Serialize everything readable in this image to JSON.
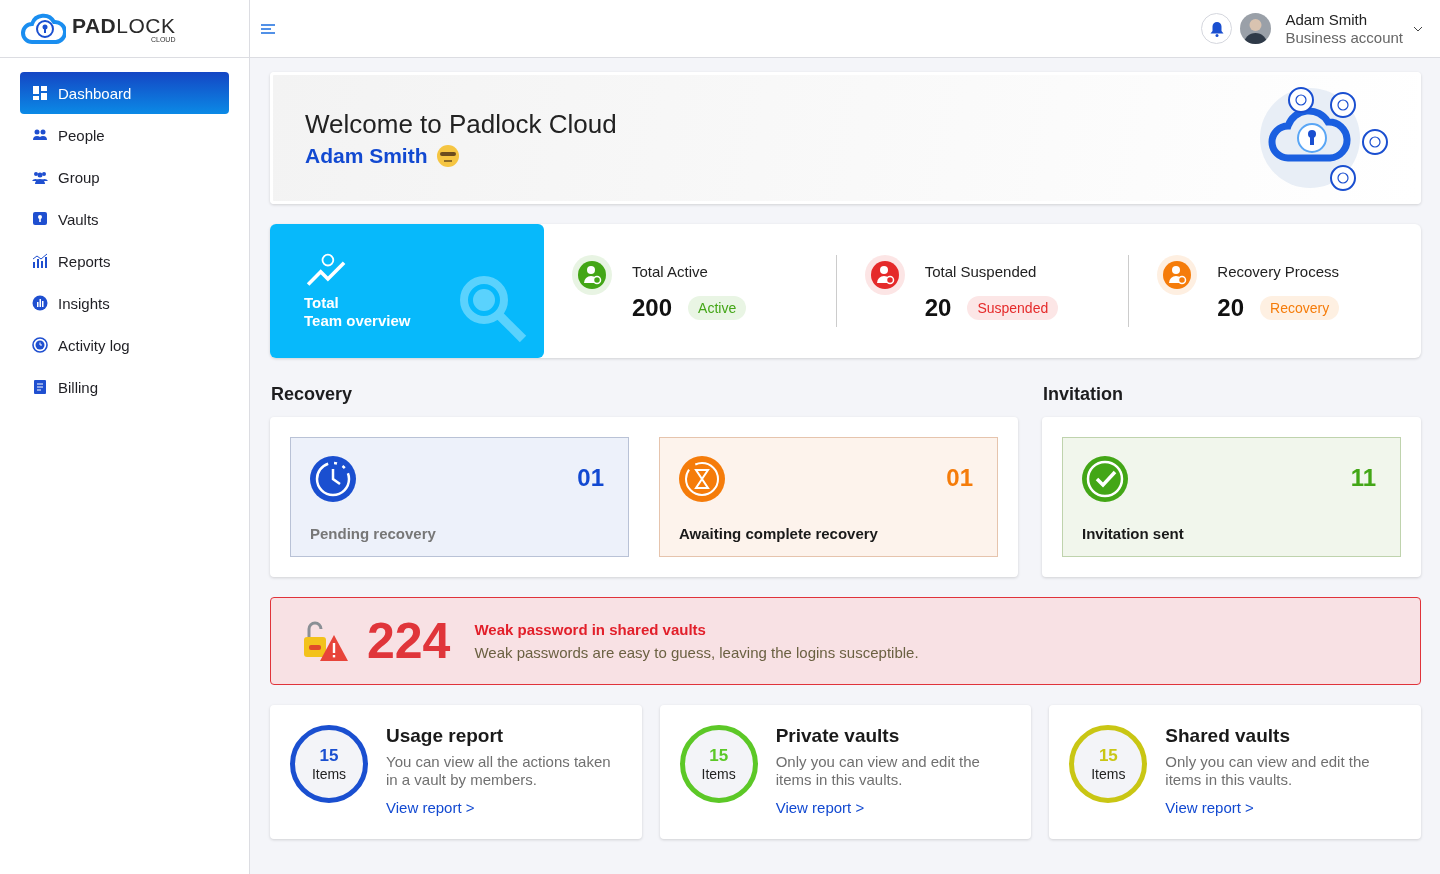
{
  "logo": {
    "name": "**PAD**LOCK",
    "sub": "CLOUD"
  },
  "sidebar": {
    "items": [
      {
        "label": "Dashboard",
        "kind": "grid",
        "selected": true
      },
      {
        "label": "People",
        "kind": "people",
        "selected": false
      },
      {
        "label": "Group",
        "kind": "group",
        "selected": false
      },
      {
        "label": "Vaults",
        "kind": "vault",
        "selected": false
      },
      {
        "label": "Reports",
        "kind": "chart",
        "selected": false
      },
      {
        "label": "Insights",
        "kind": "insight",
        "selected": false
      },
      {
        "label": "Activity log",
        "kind": "clock",
        "selected": false
      },
      {
        "label": "Billing",
        "kind": "bill",
        "selected": false
      }
    ]
  },
  "header": {
    "user_name": "Adam Smith",
    "account": "Business account"
  },
  "welcome": {
    "title": "Welcome to Padlock Cloud",
    "name": "Adam Smith"
  },
  "overview": {
    "line_1": "Total",
    "line_2": "Team overview"
  },
  "stats": [
    {
      "label": "Total Active",
      "value": "200",
      "badge": "Active",
      "color": "#43a616"
    },
    {
      "label": "Total Suspended",
      "value": "20",
      "badge": "Suspended",
      "color": "#e52a2a"
    },
    {
      "label": "Recovery Process",
      "value": "20",
      "badge": "Recovery",
      "color": "#f57c0a"
    }
  ],
  "recovery": {
    "title": "Recovery",
    "cards": [
      {
        "kind": "pending",
        "count": "01",
        "label": "Pending recovery"
      },
      {
        "kind": "awaiting",
        "count": "01",
        "label": "Awaiting complete recovery"
      }
    ]
  },
  "invitation": {
    "title": "Invitation",
    "cards": [
      {
        "kind": "invited",
        "count": "11",
        "label": "Invitation sent"
      }
    ]
  },
  "alert": {
    "count": "224",
    "title": "Weak password in shared vaults",
    "text": "Weak passwords are easy to guess, leaving the logins susceptible."
  },
  "reports": [
    {
      "count": "15",
      "unit": "Items",
      "title": "Usage report",
      "text": "You can view all the actions taken in a vault by members.",
      "link": "View report >",
      "color": "#1a4fd0"
    },
    {
      "count": "15",
      "unit": "Items",
      "title": "Private vaults",
      "text": "Only you can view and edit the items in this vaults.",
      "link": "View report >",
      "color": "#5cc827"
    },
    {
      "count": "15",
      "unit": "Items",
      "title": "Shared vaults",
      "text": "Only you can view and edit the items in this vaults.",
      "link": "View report >",
      "color": "#c9c614"
    }
  ]
}
